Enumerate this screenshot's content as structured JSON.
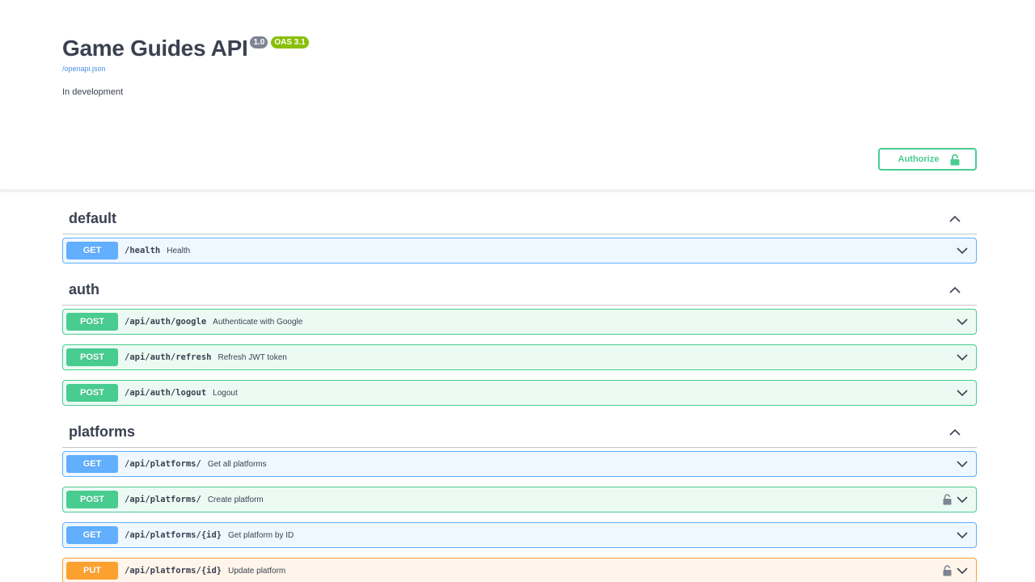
{
  "info": {
    "title": "Game Guides API",
    "version": "1.0",
    "oas": "OAS 3.1",
    "spec_link": "/openapi.json",
    "description": "In development"
  },
  "authorize": {
    "label": "Authorize"
  },
  "tags": [
    {
      "name": "default",
      "operations": [
        {
          "method": "GET",
          "path": "/health",
          "summary": "Health",
          "locked": false
        }
      ]
    },
    {
      "name": "auth",
      "operations": [
        {
          "method": "POST",
          "path": "/api/auth/google",
          "summary": "Authenticate with Google",
          "locked": false
        },
        {
          "method": "POST",
          "path": "/api/auth/refresh",
          "summary": "Refresh JWT token",
          "locked": false
        },
        {
          "method": "POST",
          "path": "/api/auth/logout",
          "summary": "Logout",
          "locked": false
        }
      ]
    },
    {
      "name": "platforms",
      "operations": [
        {
          "method": "GET",
          "path": "/api/platforms/",
          "summary": "Get all platforms",
          "locked": false
        },
        {
          "method": "POST",
          "path": "/api/platforms/",
          "summary": "Create platform",
          "locked": true
        },
        {
          "method": "GET",
          "path": "/api/platforms/{id}",
          "summary": "Get platform by ID",
          "locked": false
        },
        {
          "method": "PUT",
          "path": "/api/platforms/{id}",
          "summary": "Update platform",
          "locked": true
        }
      ]
    }
  ],
  "colors": {
    "get": "#61affe",
    "post": "#49cc90",
    "put": "#fca130",
    "text": "#3b4151",
    "link": "#4990e2",
    "version_badge": "#7d8492",
    "oas_badge": "#89bf04"
  },
  "icons": {
    "authorize": "lock-icon",
    "tag_toggle": "chevron-up-icon",
    "op_toggle": "chevron-down-icon",
    "op_auth": "lock-icon"
  }
}
